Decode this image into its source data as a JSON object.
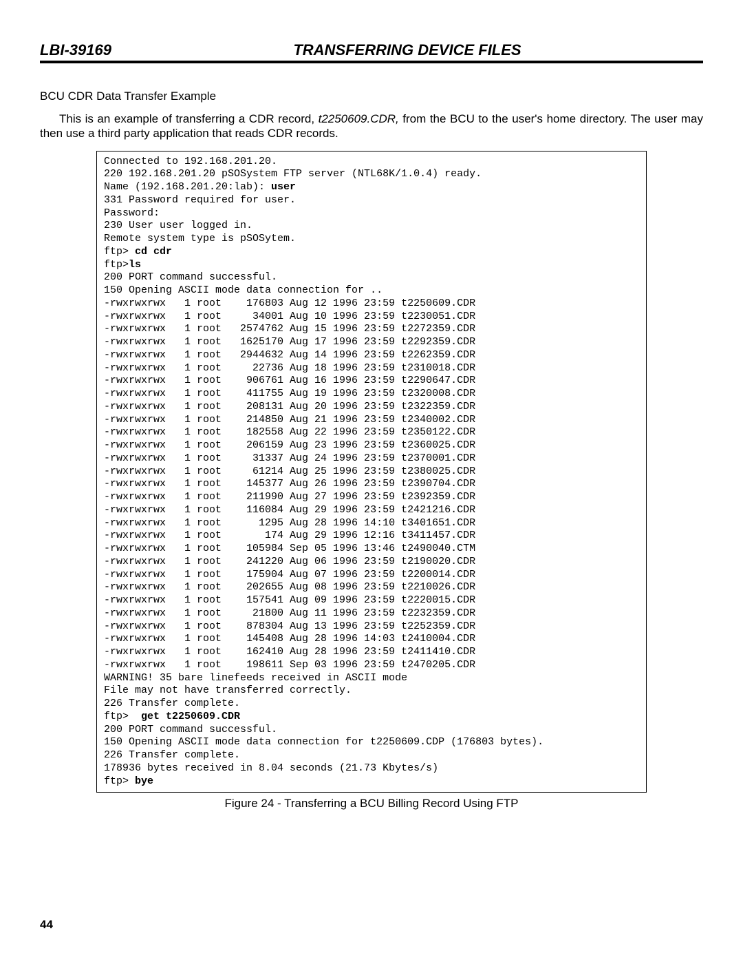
{
  "header": {
    "doc_id": "LBI-39169",
    "title": "TRANSFERRING DEVICE FILES"
  },
  "section_title": "BCU CDR Data Transfer Example",
  "paragraph": {
    "lead": "This is an example of transferring a CDR record, ",
    "fname_italic": "t2250609.CDR,",
    "tail": " from the BCU to the user's home directory.  The user may then use a third party application that reads CDR records."
  },
  "terminal": {
    "l01": "Connected to 192.168.201.20.",
    "l02": "220 192.168.201.20 pSOSystem FTP server (NTL68K/1.0.4) ready.",
    "l03a": "Name (192.168.201.20:lab): ",
    "l03b": "user",
    "l04": "331 Password required for user.",
    "l05": "Password:",
    "l06": "230 User user logged in.",
    "l07": "Remote system type is pSOSytem.",
    "l08a": "ftp> ",
    "l08b": "cd cdr",
    "l09a": "ftp>",
    "l09b": "ls",
    "l10": "200 PORT command successful.",
    "l11": "150 Opening ASCII mode data connection for ..",
    "r01": "-rwxrwxrwx   1 root    176803 Aug 12 1996 23:59 t2250609.CDR",
    "r02": "-rwxrwxrwx   1 root     34001 Aug 10 1996 23:59 t2230051.CDR",
    "r03": "-rwxrwxrwx   1 root   2574762 Aug 15 1996 23:59 t2272359.CDR",
    "r04": "-rwxrwxrwx   1 root   1625170 Aug 17 1996 23:59 t2292359.CDR",
    "r05": "-rwxrwxrwx   1 root   2944632 Aug 14 1996 23:59 t2262359.CDR",
    "r06": "-rwxrwxrwx   1 root     22736 Aug 18 1996 23:59 t2310018.CDR",
    "r07": "-rwxrwxrwx   1 root    906761 Aug 16 1996 23:59 t2290647.CDR",
    "r08": "-rwxrwxrwx   1 root    411755 Aug 19 1996 23:59 t2320008.CDR",
    "r09": "-rwxrwxrwx   1 root    208131 Aug 20 1996 23:59 t2322359.CDR",
    "r10": "-rwxrwxrwx   1 root    214850 Aug 21 1996 23:59 t2340002.CDR",
    "r11": "-rwxrwxrwx   1 root    182558 Aug 22 1996 23:59 t2350122.CDR",
    "r12": "-rwxrwxrwx   1 root    206159 Aug 23 1996 23:59 t2360025.CDR",
    "r13": "-rwxrwxrwx   1 root     31337 Aug 24 1996 23:59 t2370001.CDR",
    "r14": "-rwxrwxrwx   1 root     61214 Aug 25 1996 23:59 t2380025.CDR",
    "r15": "-rwxrwxrwx   1 root    145377 Aug 26 1996 23:59 t2390704.CDR",
    "r16": "-rwxrwxrwx   1 root    211990 Aug 27 1996 23:59 t2392359.CDR",
    "r17": "-rwxrwxrwx   1 root    116084 Aug 29 1996 23:59 t2421216.CDR",
    "r18": "-rwxrwxrwx   1 root      1295 Aug 28 1996 14:10 t3401651.CDR",
    "r19": "-rwxrwxrwx   1 root       174 Aug 29 1996 12:16 t3411457.CDR",
    "r20": "-rwxrwxrwx   1 root    105984 Sep 05 1996 13:46 t2490040.CTM",
    "r21": "-rwxrwxrwx   1 root    241220 Aug 06 1996 23:59 t2190020.CDR",
    "r22": "-rwxrwxrwx   1 root    175904 Aug 07 1996 23:59 t2200014.CDR",
    "r23": "-rwxrwxrwx   1 root    202655 Aug 08 1996 23:59 t2210026.CDR",
    "r24": "-rwxrwxrwx   1 root    157541 Aug 09 1996 23:59 t2220015.CDR",
    "r25": "-rwxrwxrwx   1 root     21800 Aug 11 1996 23:59 t2232359.CDR",
    "r26": "-rwxrwxrwx   1 root    878304 Aug 13 1996 23:59 t2252359.CDR",
    "r27": "-rwxrwxrwx   1 root    145408 Aug 28 1996 14:03 t2410004.CDR",
    "r28": "-rwxrwxrwx   1 root    162410 Aug 28 1996 23:59 t2411410.CDR",
    "r29": "-rwxrwxrwx   1 root    198611 Sep 03 1996 23:59 t2470205.CDR",
    "w1": "WARNING! 35 bare linefeeds received in ASCII mode",
    "w2": "File may not have transferred correctly.",
    "t1": "226 Transfer complete.",
    "g1a": "ftp>  ",
    "g1b": "get t2250609.CDR",
    "g2": "200 PORT command successful.",
    "g3": "150 Opening ASCII mode data connection for t2250609.CDP (176803 bytes).",
    "g4": "226 Transfer complete.",
    "g5": "178936 bytes received in 8.04 seconds (21.73 Kbytes/s)",
    "g6a": "ftp> ",
    "g6b": "bye"
  },
  "figure_caption": "Figure 24 - Transferring a BCU Billing Record Using FTP",
  "page_number": "44"
}
